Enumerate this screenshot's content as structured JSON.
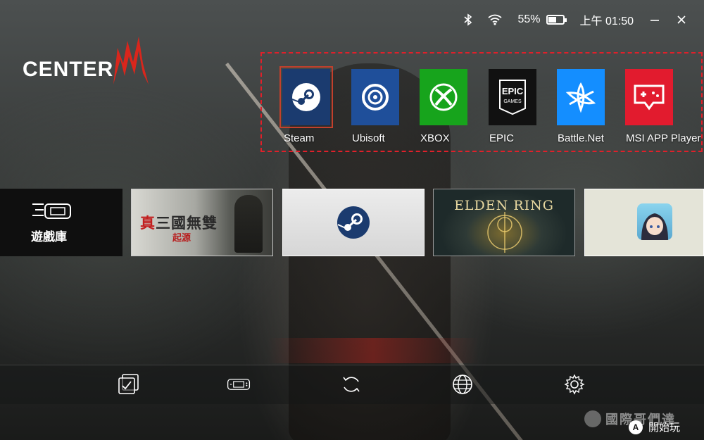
{
  "status_bar": {
    "battery_percent": "55%",
    "battery_level": 0.55,
    "time": "上午 01:50",
    "bluetooth_icon": "bluetooth-icon",
    "wifi_icon": "wifi-icon"
  },
  "logo": {
    "text": "CENTER",
    "mark": "M"
  },
  "launchers": [
    {
      "label": "Steam",
      "icon": "steam-icon",
      "color": "#1b3b6f"
    },
    {
      "label": "Ubisoft",
      "icon": "ubisoft-icon",
      "color": "#1f4f9a"
    },
    {
      "label": "XBOX",
      "icon": "xbox-icon",
      "color": "#17a41c"
    },
    {
      "label": "EPIC",
      "icon": "epic-icon",
      "color": "#111111"
    },
    {
      "label": "Battle.Net",
      "icon": "battlenet-icon",
      "color": "#148eff"
    },
    {
      "label": "MSI APP Player",
      "icon": "msi-app-player-icon",
      "color": "#e21b2e"
    }
  ],
  "games": {
    "library_label": "遊戲庫",
    "sangoku_prefix": "真",
    "sangoku_title": "三國無雙",
    "sangoku_sub": "起源",
    "elden_title": "ELDEN RING"
  },
  "bottom_bar": [
    {
      "icon": "task-check-icon"
    },
    {
      "icon": "handheld-console-icon"
    },
    {
      "icon": "refresh-icon"
    },
    {
      "icon": "globe-icon"
    },
    {
      "icon": "settings-gear-icon"
    }
  ],
  "footer": {
    "button": "A",
    "hint": "開始玩"
  },
  "watermark": {
    "text": "國際哥們達"
  }
}
